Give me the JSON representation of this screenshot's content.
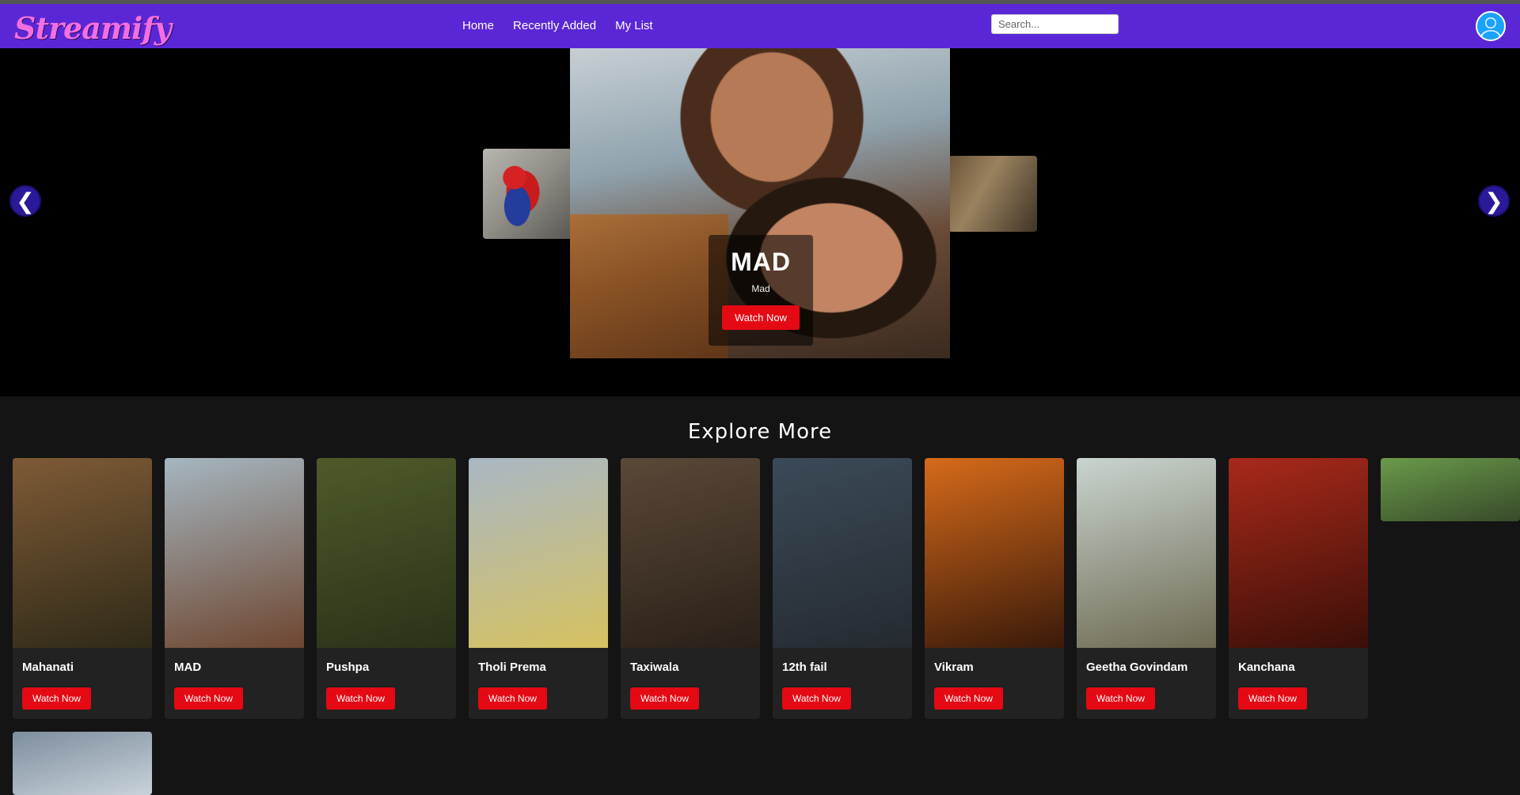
{
  "app": {
    "logo": "Streamify"
  },
  "nav": {
    "items": [
      "Home",
      "Recently Added",
      "My List"
    ]
  },
  "search": {
    "placeholder": "Search..."
  },
  "hero": {
    "title": "MAD",
    "subtitle": "Mad",
    "button_label": "Watch Now",
    "prev_label": "❮",
    "next_label": "❯"
  },
  "explore": {
    "title": "Explore More",
    "button_label": "Watch Now",
    "movies": [
      {
        "name": "Mahanati",
        "colors": [
          "#7e5a36",
          "#2f2a18"
        ]
      },
      {
        "name": "MAD",
        "colors": [
          "#a5b6c0",
          "#6e4630"
        ]
      },
      {
        "name": "Pushpa",
        "colors": [
          "#4e5a2a",
          "#2a3218"
        ]
      },
      {
        "name": "Tholi Prema",
        "colors": [
          "#a9b7c4",
          "#d6c260"
        ]
      },
      {
        "name": "Taxiwala",
        "colors": [
          "#5a4838",
          "#2a2018"
        ]
      },
      {
        "name": "12th fail",
        "colors": [
          "#3b4a58",
          "#252a30"
        ]
      },
      {
        "name": "Vikram",
        "colors": [
          "#d66a1a",
          "#3a1a0a"
        ]
      },
      {
        "name": "Geetha Govindam",
        "colors": [
          "#c9d4cf",
          "#6e6a52"
        ]
      },
      {
        "name": "Kanchana",
        "colors": [
          "#a8291a",
          "#3a0f08"
        ]
      }
    ],
    "partial_movies": [
      {
        "colors": [
          "#6a9a4a",
          "#384a2a"
        ]
      },
      {
        "colors": [
          "#7e8e9e",
          "#c8d2da"
        ]
      }
    ]
  }
}
